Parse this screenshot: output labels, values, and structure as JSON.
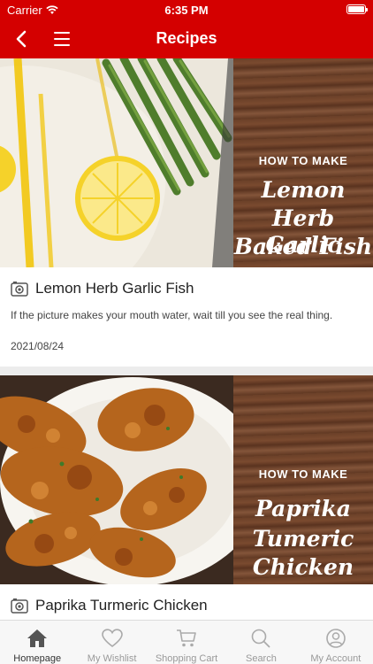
{
  "status_bar": {
    "carrier": "Carrier",
    "time": "6:35 PM"
  },
  "nav": {
    "title": "Recipes"
  },
  "recipes": [
    {
      "title": "Lemon Herb Garlic Fish",
      "description": "If the picture makes your mouth water, wait till you see the real thing.",
      "date": "2021/08/24",
      "image_caption": {
        "how_to": "HOW TO MAKE",
        "line1": "Lemon",
        "line2": "Herb Garlic",
        "line3": "Baked Fish"
      }
    },
    {
      "title": "Paprika Turmeric Chicken",
      "image_caption": {
        "how_to": "HOW TO MAKE",
        "line1": "Paprika",
        "line2": "Tumeric",
        "line3": "Chicken"
      }
    }
  ],
  "tabs": [
    {
      "label": "Homepage",
      "icon": "home-icon",
      "active": true
    },
    {
      "label": "My Wishlist",
      "icon": "heart-icon",
      "active": false
    },
    {
      "label": "Shopping Cart",
      "icon": "cart-icon",
      "active": false
    },
    {
      "label": "Search",
      "icon": "search-icon",
      "active": false
    },
    {
      "label": "My Account",
      "icon": "account-icon",
      "active": false
    }
  ],
  "colors": {
    "brand": "#d40000",
    "tab_active": "#555555",
    "tab_inactive": "#aaaaaa"
  }
}
